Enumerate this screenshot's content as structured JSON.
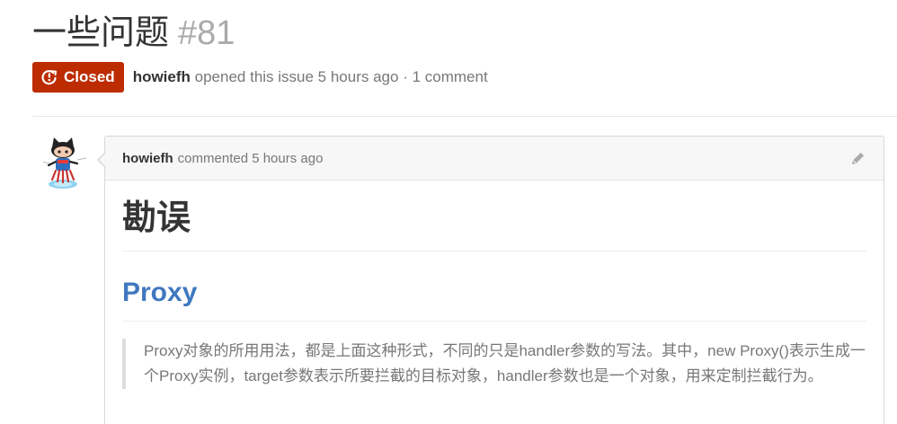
{
  "issue": {
    "title": "一些问题",
    "number": "#81",
    "state_label": "Closed",
    "author": "howiefh",
    "opened_text": "opened this issue 5 hours ago · 1 comment"
  },
  "comment": {
    "author": "howiefh",
    "action_text": "commented 5 hours ago",
    "heading": "勘误",
    "subheading": "Proxy",
    "quote": "Proxy对象的所用用法，都是上面这种形式，不同的只是handler参数的写法。其中，new Proxy()表示生成一个Proxy实例，target参数表示所要拦截的目标对象，handler参数也是一个对象，用来定制拦截行为。"
  },
  "colors": {
    "closed_badge": "#bd2c00",
    "link": "#4078c0"
  },
  "icons": {
    "state": "issue-closed-icon",
    "edit": "pencil-icon",
    "avatar": "octocat-avatar"
  }
}
